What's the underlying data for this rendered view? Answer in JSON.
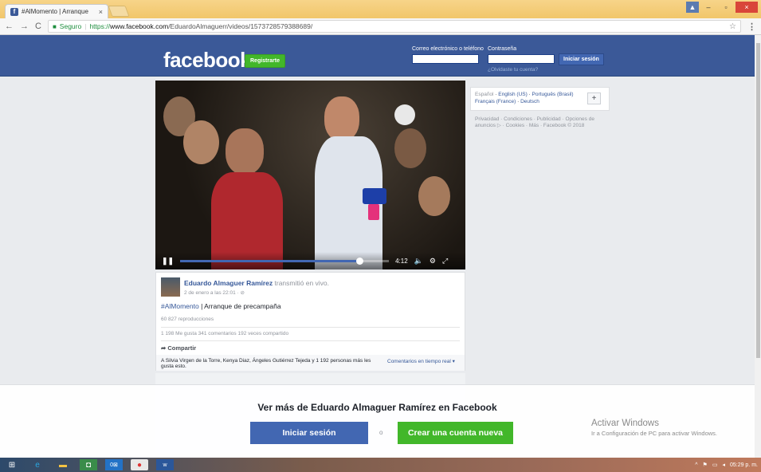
{
  "browser": {
    "tab_title": "#AlMomento | Arranque",
    "tab_close": "×",
    "address": {
      "secure_label": "Seguro",
      "url_scheme": "https://",
      "url_domain": "www.facebook.com",
      "url_path": "/EduardoAlmaguerr/videos/1573728579388689/"
    },
    "win_min": "–",
    "win_max": "▫",
    "win_close": "×"
  },
  "fb_header": {
    "logo": "facebook",
    "register_label": "Registrarte",
    "email_label": "Correo electrónico o teléfono",
    "password_label": "Contraseña",
    "login_label": "Iniciar sesión",
    "forgot_label": "¿Olvidaste tu cuenta?"
  },
  "video": {
    "time": "4:12",
    "progress_fraction": 0.86
  },
  "post": {
    "author": "Eduardo Almaguer Ramírez",
    "action": " transmitió en vivo.",
    "time": "2 de enero a las 22:01 · ⊘",
    "hashtag": "#AlMomento",
    "text": " | Arranque de precampaña",
    "views": "60 827 reproducciones",
    "stats": "1 198 Me gusta   341 comentarios   192 veces compartido",
    "share_label": "Compartir",
    "likes_text": "A Silvia Virgen de la Torre, Kenya Diaz, Ángeles Gutiérrez Tejeda y 1 192 personas más les gusta esto.",
    "realtime_label": "Comentarios en tiempo real ▾"
  },
  "sidebar": {
    "current_lang": "Español",
    "langs": [
      "English (US)",
      "Português (Brasil)",
      "Français (France)",
      "Deutsch"
    ],
    "plus_label": "+",
    "footer": "Privacidad · Condiciones · Publicidad · Opciones de anuncios ▷ · Cookies · Más · Facebook © 2018"
  },
  "overlay": {
    "title": "Ver más de Eduardo Almaguer Ramírez en Facebook",
    "login_label": "Iniciar sesión",
    "or_label": "o",
    "create_label": "Crear una cuenta nueva"
  },
  "watermark": {
    "line1": "Activar Windows",
    "line2": "Ir a Configuración de PC para activar Windows."
  },
  "taskbar": {
    "clock": "05:29 p. m."
  }
}
